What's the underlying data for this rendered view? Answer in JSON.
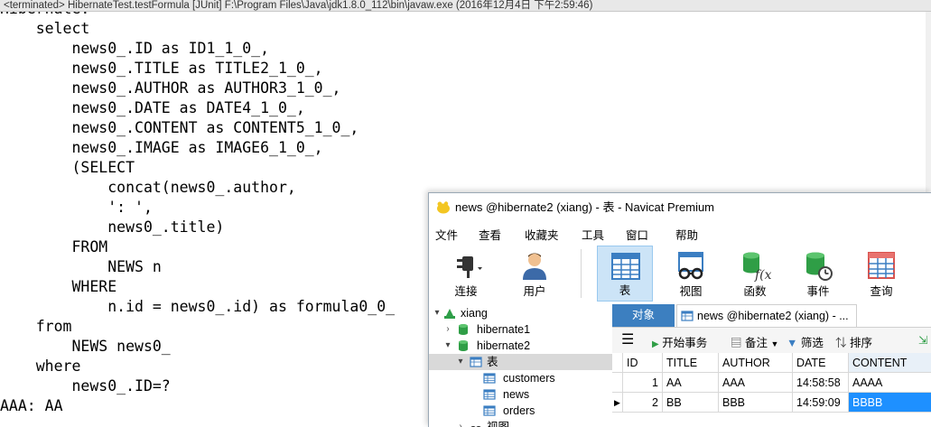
{
  "console": {
    "titlebar": "<terminated> HibernateTest.testFormula [JUnit] F:\\Program Files\\Java\\jdk1.8.0_112\\bin\\javaw.exe (2016年12月4日 下午2:59:46)",
    "lines": [
      "Hibernate:",
      "    select",
      "        news0_.ID as ID1_1_0_,",
      "        news0_.TITLE as TITLE2_1_0_,",
      "        news0_.AUTHOR as AUTHOR3_1_0_,",
      "        news0_.DATE as DATE4_1_0_,",
      "        news0_.CONTENT as CONTENT5_1_0_,",
      "        news0_.IMAGE as IMAGE6_1_0_,",
      "        (SELECT",
      "            concat(news0_.author,",
      "            ': ',",
      "            news0_.title)",
      "        FROM",
      "            NEWS n",
      "        WHERE",
      "            n.id = news0_.id) as formula0_0_",
      "    from",
      "        NEWS news0_",
      "    where",
      "        news0_.ID=?",
      "AAA: AA"
    ]
  },
  "navicat": {
    "title": "news @hibernate2 (xiang) - 表 - Navicat Premium",
    "menu": [
      "文件",
      "查看",
      "收藏夹",
      "工具",
      "窗口",
      "帮助"
    ],
    "toolbar": {
      "connect": "连接",
      "user": "用户",
      "table": "表",
      "view": "视图",
      "function": "函数",
      "event": "事件",
      "query": "查询"
    },
    "tree": {
      "connection": "xiang",
      "db1": "hibernate1",
      "db2": "hibernate2",
      "tables_node": "表",
      "tables": [
        "customers",
        "news",
        "orders"
      ],
      "views_node": "视图"
    },
    "tabs": {
      "objects": "对象",
      "table_tab": "news @hibernate2 (xiang) - ..."
    },
    "subtoolbar": {
      "begin_transaction": "开始事务",
      "note": "备注",
      "filter": "筛选",
      "sort": "排序"
    },
    "grid": {
      "columns": [
        "ID",
        "TITLE",
        "AUTHOR",
        "DATE",
        "CONTENT"
      ],
      "rows": [
        {
          "id": "1",
          "title": "AA",
          "author": "AAA",
          "date": "14:58:58",
          "content": "AAAA"
        },
        {
          "id": "2",
          "title": "BB",
          "author": "BBB",
          "date": "14:59:09",
          "content": "BBBB"
        }
      ]
    }
  }
}
